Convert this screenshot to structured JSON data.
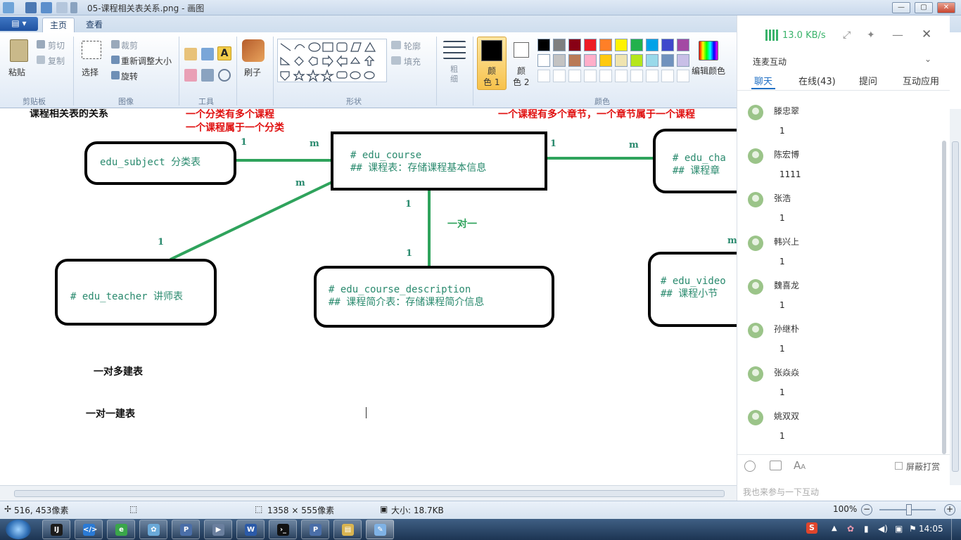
{
  "window": {
    "title": "05-课程相关表关系.png - 画图",
    "min": "—",
    "max": "▢",
    "close": "✕"
  },
  "ribbon": {
    "menu_label": "▤ ▾",
    "tabs": [
      "主页",
      "查看"
    ],
    "clipboard": {
      "paste": "粘贴",
      "cut": "剪切",
      "copy": "复制",
      "group": "剪贴板"
    },
    "image": {
      "select": "选择",
      "crop": "裁剪",
      "resize": "重新调整大小",
      "rotate": "旋转",
      "group": "图像"
    },
    "tools": {
      "group": "工具"
    },
    "brush": {
      "label": "刷子"
    },
    "shapes": {
      "outline": "轮廓",
      "fill": "填充",
      "group": "形状"
    },
    "size": {
      "label": "粗\n细"
    },
    "color1": {
      "line1": "颜",
      "line2": "色 1"
    },
    "color2": {
      "line1": "颜",
      "line2": "色 2"
    },
    "edit_colors": "编辑颜色",
    "colors_group": "颜色",
    "palette_row1": [
      "#000000",
      "#7f7f7f",
      "#880015",
      "#ed1c24",
      "#ff7f27",
      "#fff200",
      "#22b14c",
      "#00a2e8",
      "#3f48cc",
      "#a349a4"
    ],
    "palette_row2": [
      "#ffffff",
      "#c3c3c3",
      "#b97a57",
      "#ffaec9",
      "#ffc90e",
      "#efe4b0",
      "#b5e61d",
      "#99d9ea",
      "#7092be",
      "#c8bfe7"
    ]
  },
  "diagram": {
    "heading": "课程相关表的关系",
    "note_subject": [
      "一个分类有多个课程",
      "一个课程属于一个分类"
    ],
    "note_chapter": "一个课程有多个章节，一个章节属于一个课程",
    "subject_box": "edu_subject 分类表",
    "course_box": [
      "# edu_course",
      "## 课程表：存储课程基本信息"
    ],
    "chapter_box": [
      "# edu_cha",
      "## 课程章"
    ],
    "teacher_box": "# edu_teacher 讲师表",
    "description_box": [
      "# edu_course_description",
      "## 课程简介表：存储课程简介信息"
    ],
    "video_box": [
      "# edu_video",
      "## 课程小节"
    ],
    "labels": {
      "one": "1",
      "many": "m"
    },
    "one_to_one": "一对一",
    "one_to_many_build": "一对多建表",
    "one_to_one_build": "一对一建表"
  },
  "status": {
    "cursor_pos": "516, 453像素",
    "image_size": "1358 × 555像素",
    "file_size": "大小: 18.7KB",
    "zoom": "100%"
  },
  "chat": {
    "speed": "13.0 KB/s",
    "room": "连麦互动",
    "tabs": [
      "聊天",
      "在线(43)",
      "提问",
      "互动应用"
    ],
    "messages": [
      {
        "name": "滕忠翠",
        "text": "1"
      },
      {
        "name": "陈宏博",
        "text": "1111"
      },
      {
        "name": "张浩",
        "text": "1"
      },
      {
        "name": "韩兴上",
        "text": "1"
      },
      {
        "name": "魏喜龙",
        "text": "1"
      },
      {
        "name": "孙继朴",
        "text": "1"
      },
      {
        "name": "张焱焱",
        "text": "1"
      },
      {
        "name": "姚双双",
        "text": "1"
      }
    ],
    "block_label": "屏蔽打赏",
    "input_placeholder": "我也来参与一下互动"
  },
  "taskbar": {
    "clock": "14:05"
  }
}
